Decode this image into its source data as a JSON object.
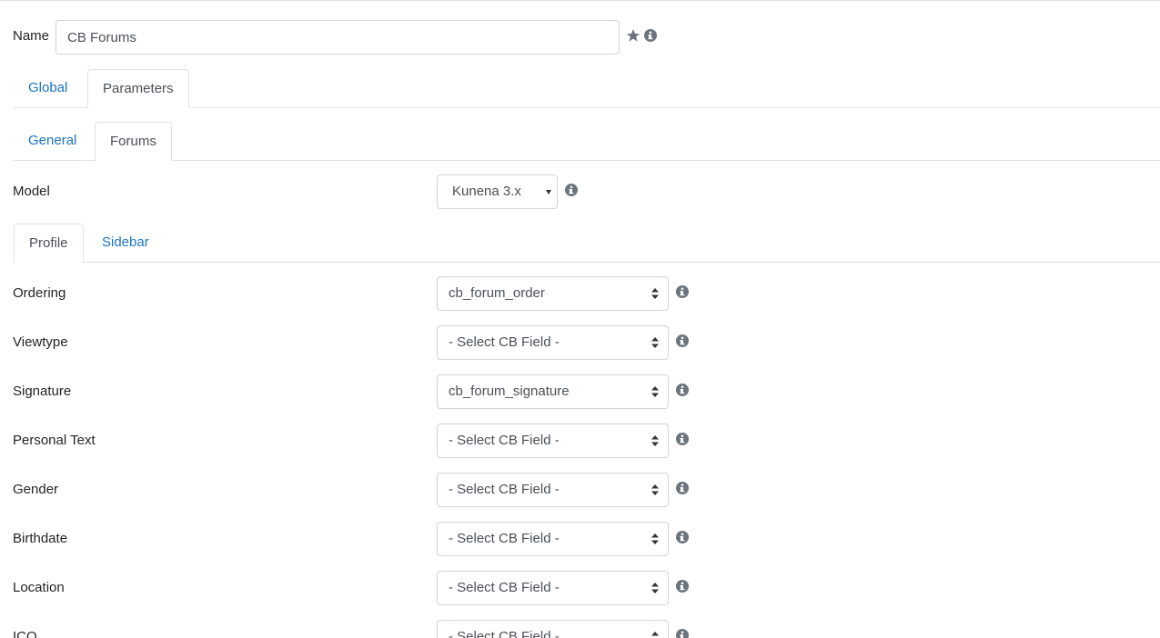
{
  "name": {
    "label": "Name",
    "value": "CB Forums"
  },
  "main_tabs": [
    {
      "label": "Global",
      "active": false
    },
    {
      "label": "Parameters",
      "active": true
    }
  ],
  "sub_tabs": [
    {
      "label": "General",
      "active": false
    },
    {
      "label": "Forums",
      "active": true
    }
  ],
  "model": {
    "label": "Model",
    "value": "Kunena 3.x"
  },
  "profile_tabs": [
    {
      "label": "Profile",
      "active": true
    },
    {
      "label": "Sidebar",
      "active": false
    }
  ],
  "fields": [
    {
      "label": "Ordering",
      "value": "cb_forum_order"
    },
    {
      "label": "Viewtype",
      "value": "- Select CB Field -"
    },
    {
      "label": "Signature",
      "value": "cb_forum_signature"
    },
    {
      "label": "Personal Text",
      "value": "- Select CB Field -"
    },
    {
      "label": "Gender",
      "value": "- Select CB Field -"
    },
    {
      "label": "Birthdate",
      "value": "- Select CB Field -"
    },
    {
      "label": "Location",
      "value": "- Select CB Field -"
    },
    {
      "label": "ICQ",
      "value": "- Select CB Field -"
    }
  ],
  "icons": {
    "star": "star-icon",
    "info": "info-icon"
  },
  "colors": {
    "link": "#1a73c2",
    "border": "#dee2e6",
    "icon": "#6c757d"
  }
}
